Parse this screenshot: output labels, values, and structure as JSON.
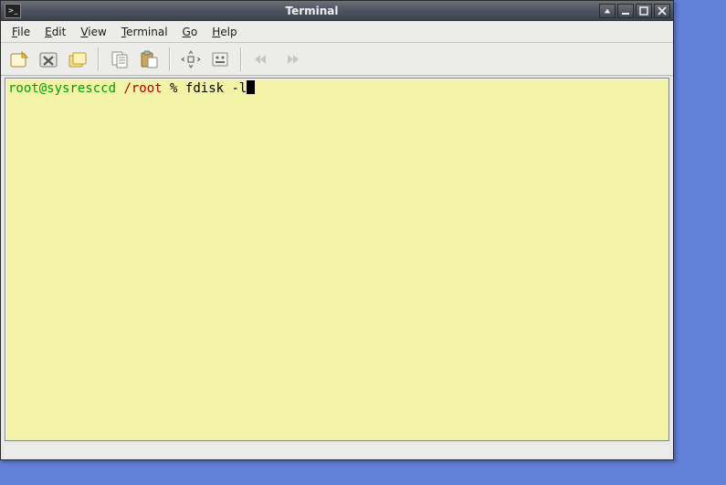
{
  "window": {
    "title": "Terminal"
  },
  "menubar": {
    "items": [
      {
        "label": "File",
        "accel": "F"
      },
      {
        "label": "Edit",
        "accel": "E"
      },
      {
        "label": "View",
        "accel": "V"
      },
      {
        "label": "Terminal",
        "accel": "T"
      },
      {
        "label": "Go",
        "accel": "G"
      },
      {
        "label": "Help",
        "accel": "H"
      }
    ]
  },
  "toolbar": {
    "icons": [
      "new-tab-icon",
      "close-tab-icon",
      "new-window-icon",
      "separator",
      "copy-icon",
      "paste-icon",
      "separator",
      "fullscreen-icon",
      "preferences-icon",
      "separator",
      "prev-tab-icon",
      "next-tab-icon"
    ]
  },
  "terminal": {
    "prompt_user": "root@sysresccd",
    "prompt_sep": " ",
    "prompt_path": "/root",
    "prompt_symbol": " % ",
    "command": "fdisk -l",
    "colors": {
      "bg": "#f3f3a8",
      "user": "#00a000",
      "path": "#b00000",
      "text": "#000000",
      "cursor": "#000000"
    }
  },
  "desktop": {
    "bg": "#6280d8"
  }
}
